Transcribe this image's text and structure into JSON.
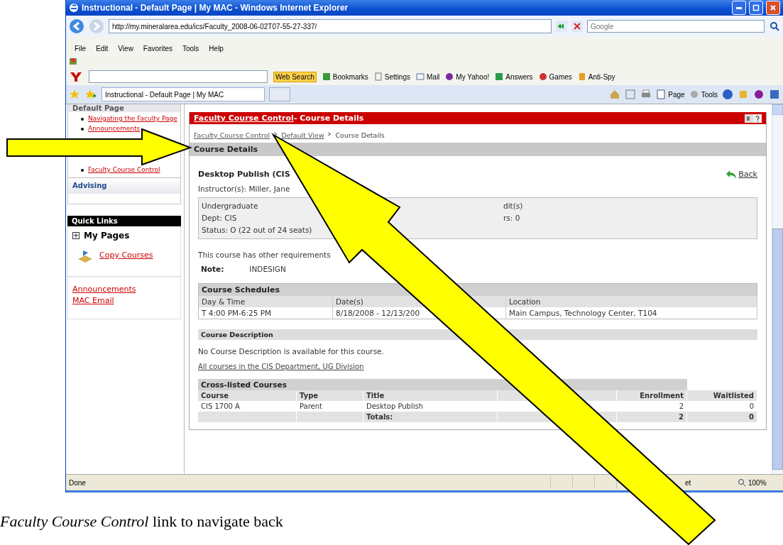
{
  "window": {
    "title": "Instructional - Default Page | My MAC - Windows Internet Explorer"
  },
  "address": {
    "url": "http://my.mineralarea.edu/ics/Faculty_2008-06-02T07-55-27-337/",
    "search_placeholder": "Google"
  },
  "menu": [
    "File",
    "Edit",
    "View",
    "Favorites",
    "Tools",
    "Help"
  ],
  "yahoo_toolbar": [
    "Web Search",
    "Bookmarks",
    "Settings",
    "Mail",
    "My Yahoo!",
    "Answers",
    "Games",
    "Anti-Spy"
  ],
  "tabs": [
    {
      "label": "Instructional - Default Page | My MAC",
      "selected": true
    }
  ],
  "command_bar": [
    "Page",
    "Tools"
  ],
  "sidebar": {
    "header": "Default Page",
    "links": [
      "Navigating the Faculty Page",
      "Announcements",
      "Faculty Course Control"
    ],
    "section": "Advising",
    "quick_links": "Quick Links",
    "my_pages": "My Pages",
    "my_pages_items": [
      "Copy Courses"
    ],
    "bottom_links": [
      "Announcements",
      "MAC Email"
    ]
  },
  "panel": {
    "title_link": "Faculty Course Control",
    "title_rest": " - Course Details",
    "breadcrumb": [
      {
        "label": "Faculty Course Control",
        "kind": "link"
      },
      {
        "label": "Default View",
        "kind": "link"
      },
      {
        "label": "Course Details",
        "kind": "current"
      }
    ],
    "section": "Course Details",
    "course_title": "Desktop Publish (CIS",
    "back": "Back",
    "instructor": "Instructor(s): Miller, Jane",
    "info_left": [
      "Undergraduate",
      "Dept: CIS",
      "Status: O (22 out of 24 seats)"
    ],
    "info_right": [
      "dit(s)",
      "rs: 0"
    ],
    "requirements": "This course has other requirements",
    "note_label": "Note:",
    "note_value": "INDESIGN",
    "schedules": {
      "title": "Course Schedules",
      "columns": [
        "Day & Time",
        "Date(s)",
        "Location"
      ],
      "rows": [
        [
          "T 4:00 PM-6:25 PM",
          "8/18/2008 - 12/13/200",
          "Main Campus, Technology Center, T104"
        ]
      ]
    },
    "description_title": "Course Description",
    "description": "No Course Description is available for this course.",
    "department_link": "All courses in the CIS Department, UG Division",
    "crosslisted": {
      "title": "Cross-listed Courses",
      "columns": [
        "Course",
        "Type",
        "Title",
        "Enrollment",
        "Waitlisted"
      ],
      "rows": [
        {
          "course": "CIS 1700 A",
          "type": "Parent",
          "title": "Desktop Publish",
          "enrollment": "2",
          "waitlisted": "0"
        }
      ],
      "totals": {
        "label": "Totals:",
        "enrollment": "2",
        "waitlisted": "0"
      }
    }
  },
  "status_bar": {
    "text": "Done",
    "zone": "et",
    "zoom": "100%"
  },
  "caption": {
    "italic": "Faculty Course Control",
    "rest": " link to navigate back"
  }
}
